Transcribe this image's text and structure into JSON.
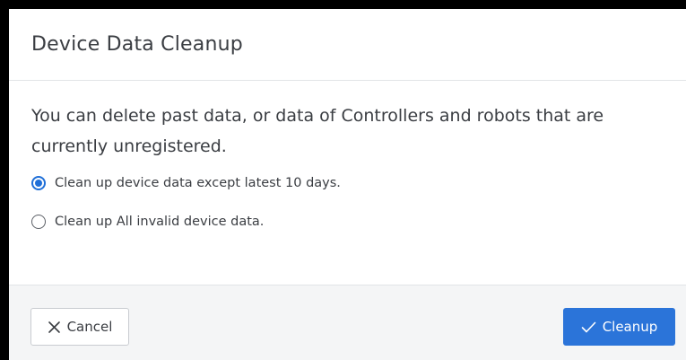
{
  "dialog": {
    "title": "Device Data Cleanup",
    "description": "You can delete past data, or data of Controllers and robots that are currently unregistered.",
    "options": [
      {
        "label": "Clean up device data except latest 10 days.",
        "selected": true
      },
      {
        "label": "Clean up All invalid device data.",
        "selected": false
      }
    ],
    "buttons": {
      "cancel_label": "Cancel",
      "cancel_icon": "close-icon",
      "cleanup_label": "Cleanup",
      "cleanup_icon": "check-icon"
    }
  },
  "colors": {
    "accent": "#2b74d9",
    "footer_bg": "#f4f5f6",
    "text": "#3a3d42"
  }
}
